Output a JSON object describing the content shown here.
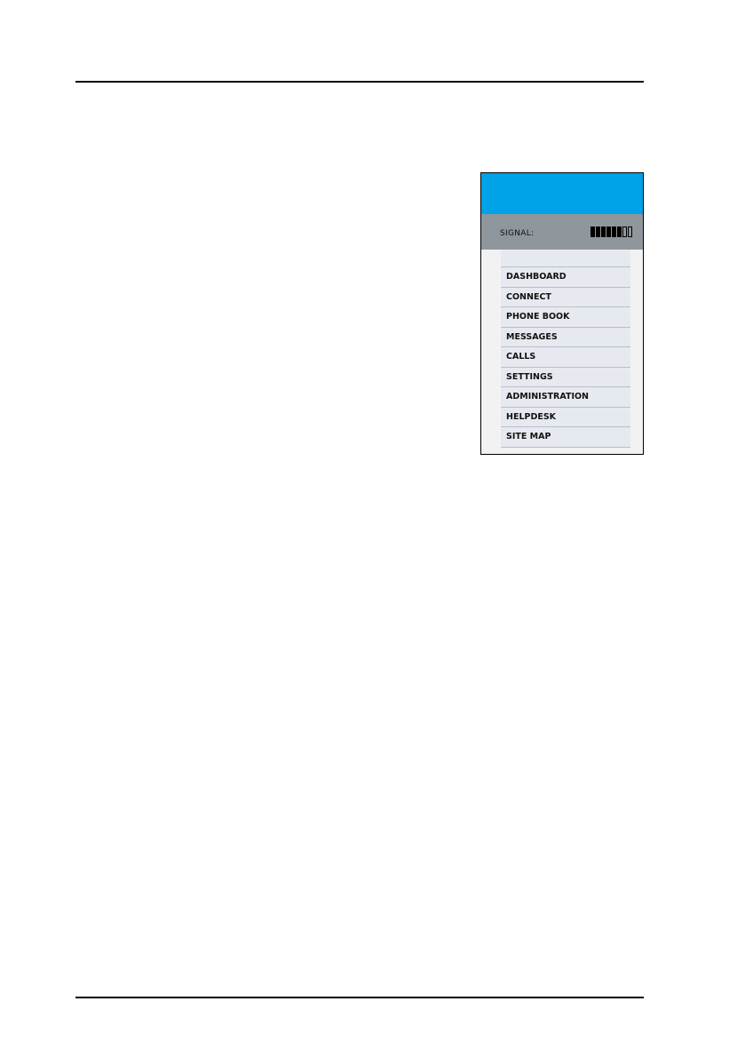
{
  "status": {
    "signal_label": "SIGNAL:",
    "signal_bars_total": 8,
    "signal_bars_filled": 6
  },
  "menu": {
    "items": [
      {
        "label": "DASHBOARD"
      },
      {
        "label": "CONNECT"
      },
      {
        "label": "PHONE BOOK"
      },
      {
        "label": "MESSAGES"
      },
      {
        "label": "CALLS"
      },
      {
        "label": "SETTINGS"
      },
      {
        "label": "ADMINISTRATION"
      },
      {
        "label": "HELPDESK"
      },
      {
        "label": "SITE MAP"
      }
    ]
  },
  "colors": {
    "banner": "#00a2e8",
    "status_bar": "#8f969c",
    "menu_bg": "#e6eaf0"
  }
}
